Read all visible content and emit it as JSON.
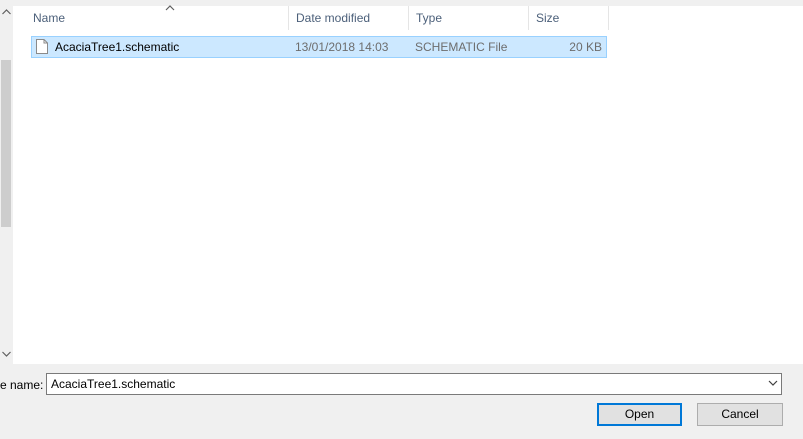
{
  "columns": {
    "name": "Name",
    "date_modified": "Date modified",
    "type": "Type",
    "size": "Size"
  },
  "files": [
    {
      "name": "AcaciaTree1.schematic",
      "date_modified": "13/01/2018 14:03",
      "type": "SCHEMATIC File",
      "size": "20 KB",
      "selected": true
    }
  ],
  "file_name": {
    "label": "e name:",
    "value": "AcaciaTree1.schematic"
  },
  "buttons": {
    "open": "Open",
    "cancel": "Cancel"
  },
  "colors": {
    "selection_bg": "#cce8ff",
    "selection_border": "#99d1ff",
    "header_text": "#4c607a",
    "default_button_border": "#0078d7"
  }
}
